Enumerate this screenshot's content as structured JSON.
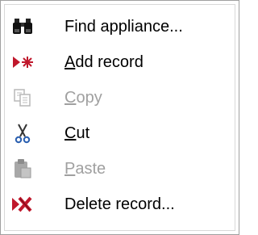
{
  "menu": {
    "items": [
      {
        "label": "Find appliance...",
        "icon": "binoculars-icon",
        "enabled": true
      },
      {
        "label": "Add record",
        "icon": "new-record-icon",
        "enabled": true,
        "accesskey": "A"
      },
      {
        "label": "Copy",
        "icon": "copy-icon",
        "enabled": false,
        "accesskey": "C"
      },
      {
        "label": "Cut",
        "icon": "scissors-icon",
        "enabled": true,
        "accesskey": "C"
      },
      {
        "label": "Paste",
        "icon": "paste-icon",
        "enabled": false,
        "accesskey": "P"
      },
      {
        "label": "Delete record...",
        "icon": "delete-record-icon",
        "enabled": true
      }
    ]
  },
  "colors": {
    "text": "#000000",
    "disabled_text": "#a0a0a0",
    "accent_red": "#c0182c",
    "border": "#a0a0a0"
  }
}
